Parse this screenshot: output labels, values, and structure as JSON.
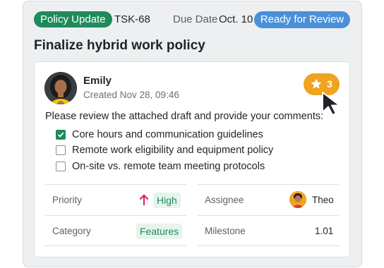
{
  "header": {
    "category_tag": "Policy Update",
    "task_id": "TSK-68",
    "due_label": "Due Date",
    "due_value": "Oct. 10",
    "status": "Ready for Review"
  },
  "title": "Finalize hybrid work policy",
  "comment": {
    "author": "Emily",
    "created": "Created Nov 28, 09:46",
    "star_count": "3",
    "text": "Please review the attached draft and provide your comments:",
    "checklist": [
      {
        "label": "Core hours and communication guidelines",
        "checked": true
      },
      {
        "label": "Remote work eligibility and equipment policy",
        "checked": false
      },
      {
        "label": "On-site vs. remote team meeting protocols",
        "checked": false
      }
    ]
  },
  "fields": {
    "priority_label": "Priority",
    "priority_value": "High",
    "assignee_label": "Assignee",
    "assignee_value": "Theo",
    "category_label": "Category",
    "category_value": "Features",
    "milestone_label": "Milestone",
    "milestone_value": "1.01"
  },
  "colors": {
    "tag_green": "#1f8a5b",
    "status_blue": "#4a90d9",
    "star_orange": "#efa31e",
    "priority_red": "#e0245e"
  },
  "icons": [
    "star-icon",
    "arrow-up-icon",
    "cursor-icon",
    "checkmark-icon"
  ]
}
